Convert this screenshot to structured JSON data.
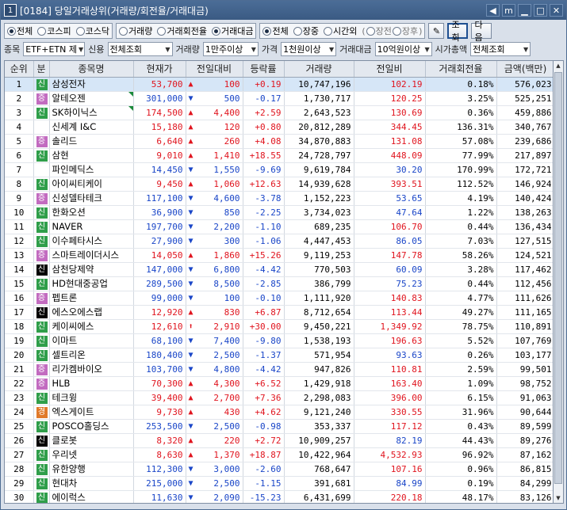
{
  "window": {
    "number": "1",
    "title": "[0184] 당일거래상위(거래량/회전율/거래대금)",
    "pin_label": "m"
  },
  "filters": {
    "market": [
      "전체",
      "코스피",
      "코스닥"
    ],
    "market_selected": 0,
    "rank_type": [
      "거래량",
      "거래회전율",
      "거래대금"
    ],
    "rank_selected": 2,
    "session": [
      "전체",
      "장중",
      "시간외"
    ],
    "session_selected": 0,
    "time_sub": [
      "장전",
      "장후"
    ],
    "query_label": "조회",
    "next_label": "다음",
    "stock_label": "종목",
    "stock_value": "ETF+ETN 제",
    "credit_label": "신용",
    "credit_value": "전체조회",
    "volume_label": "거래량",
    "volume_value": "1만주이상",
    "price_label": "가격",
    "price_value": "1천원이상",
    "amount_label": "거래대금",
    "amount_value": "10억원이상",
    "cap_label": "시가총액",
    "cap_value": "전체조회"
  },
  "columns": [
    "순위",
    "분",
    "종목명",
    "현재가",
    "전일대비",
    "등락률",
    "거래량",
    "전일비",
    "거래회전율",
    "금액(백만)"
  ],
  "rows": [
    {
      "rank": "1",
      "badge": "신",
      "badge_type": "sin",
      "name": "삼성전자",
      "tri": false,
      "price": "53,700",
      "dir": "up",
      "diff": "100",
      "rate": "+0.19",
      "vol": "10,747,196",
      "prev": "102.19",
      "prev_dir": "up",
      "turn": "0.18%",
      "amt": "576,023"
    },
    {
      "rank": "2",
      "badge": "증",
      "badge_type": "jeung",
      "name": "알테오젠",
      "tri": true,
      "price": "301,000",
      "dir": "dn",
      "diff": "500",
      "rate": "-0.17",
      "vol": "1,730,717",
      "prev": "120.25",
      "prev_dir": "up",
      "turn": "3.25%",
      "amt": "525,251"
    },
    {
      "rank": "3",
      "badge": "신",
      "badge_type": "sin",
      "name": "SK하이닉스",
      "tri": true,
      "price": "174,500",
      "dir": "up",
      "diff": "4,400",
      "rate": "+2.59",
      "vol": "2,643,523",
      "prev": "130.69",
      "prev_dir": "up",
      "turn": "0.36%",
      "amt": "459,886"
    },
    {
      "rank": "4",
      "badge": "",
      "badge_type": "none",
      "name": "신세계 I&C",
      "tri": false,
      "price": "15,180",
      "dir": "up",
      "diff": "120",
      "rate": "+0.80",
      "vol": "20,812,289",
      "prev": "344.45",
      "prev_dir": "up",
      "turn": "136.31%",
      "amt": "340,767"
    },
    {
      "rank": "5",
      "badge": "증",
      "badge_type": "jeung",
      "name": "솔리드",
      "tri": false,
      "price": "6,640",
      "dir": "up",
      "diff": "260",
      "rate": "+4.08",
      "vol": "34,870,883",
      "prev": "131.08",
      "prev_dir": "up",
      "turn": "57.08%",
      "amt": "239,686"
    },
    {
      "rank": "6",
      "badge": "신",
      "badge_type": "sin",
      "name": "삼현",
      "tri": false,
      "price": "9,010",
      "dir": "up",
      "diff": "1,410",
      "rate": "+18.55",
      "vol": "24,728,797",
      "prev": "448.09",
      "prev_dir": "up",
      "turn": "77.99%",
      "amt": "217,897"
    },
    {
      "rank": "7",
      "badge": "",
      "badge_type": "none",
      "name": "파인메딕스",
      "tri": false,
      "price": "14,450",
      "dir": "dn",
      "diff": "1,550",
      "rate": "-9.69",
      "vol": "9,619,784",
      "prev": "30.20",
      "prev_dir": "dn",
      "turn": "170.99%",
      "amt": "172,721"
    },
    {
      "rank": "8",
      "badge": "신",
      "badge_type": "sin",
      "name": "아이씨티케이",
      "tri": false,
      "price": "9,450",
      "dir": "up",
      "diff": "1,060",
      "rate": "+12.63",
      "vol": "14,939,628",
      "prev": "393.51",
      "prev_dir": "up",
      "turn": "112.52%",
      "amt": "146,924"
    },
    {
      "rank": "9",
      "badge": "증",
      "badge_type": "jeung",
      "name": "신성델타테크",
      "tri": false,
      "price": "117,100",
      "dir": "dn",
      "diff": "4,600",
      "rate": "-3.78",
      "vol": "1,152,223",
      "prev": "53.65",
      "prev_dir": "dn",
      "turn": "4.19%",
      "amt": "140,424"
    },
    {
      "rank": "10",
      "badge": "신",
      "badge_type": "sin",
      "name": "한화오션",
      "tri": false,
      "price": "36,900",
      "dir": "dn",
      "diff": "850",
      "rate": "-2.25",
      "vol": "3,734,023",
      "prev": "47.64",
      "prev_dir": "dn",
      "turn": "1.22%",
      "amt": "138,263"
    },
    {
      "rank": "11",
      "badge": "신",
      "badge_type": "sin",
      "name": "NAVER",
      "tri": false,
      "price": "197,700",
      "dir": "dn",
      "diff": "2,200",
      "rate": "-1.10",
      "vol": "689,235",
      "prev": "106.70",
      "prev_dir": "up",
      "turn": "0.44%",
      "amt": "136,434"
    },
    {
      "rank": "12",
      "badge": "신",
      "badge_type": "sin",
      "name": "이수페타시스",
      "tri": false,
      "price": "27,900",
      "dir": "dn",
      "diff": "300",
      "rate": "-1.06",
      "vol": "4,447,453",
      "prev": "86.05",
      "prev_dir": "dn",
      "turn": "7.03%",
      "amt": "127,515"
    },
    {
      "rank": "13",
      "badge": "증",
      "badge_type": "jeung",
      "name": "스마트레이더시스",
      "tri": false,
      "price": "14,050",
      "dir": "up",
      "diff": "1,860",
      "rate": "+15.26",
      "vol": "9,119,253",
      "prev": "147.78",
      "prev_dir": "up",
      "turn": "58.26%",
      "amt": "124,521"
    },
    {
      "rank": "14",
      "badge": "신",
      "badge_type": "blk",
      "name": "삼천당제약",
      "tri": false,
      "price": "147,000",
      "dir": "dn",
      "diff": "6,800",
      "rate": "-4.42",
      "vol": "770,503",
      "prev": "60.09",
      "prev_dir": "dn",
      "turn": "3.28%",
      "amt": "117,462"
    },
    {
      "rank": "15",
      "badge": "신",
      "badge_type": "sin",
      "name": "HD현대중공업",
      "tri": false,
      "price": "289,500",
      "dir": "dn",
      "diff": "8,500",
      "rate": "-2.85",
      "vol": "386,799",
      "prev": "75.23",
      "prev_dir": "dn",
      "turn": "0.44%",
      "amt": "112,456"
    },
    {
      "rank": "16",
      "badge": "증",
      "badge_type": "jeung",
      "name": "펩트론",
      "tri": false,
      "price": "99,000",
      "dir": "dn",
      "diff": "100",
      "rate": "-0.10",
      "vol": "1,111,920",
      "prev": "140.83",
      "prev_dir": "up",
      "turn": "4.77%",
      "amt": "111,626"
    },
    {
      "rank": "17",
      "badge": "신",
      "badge_type": "blk",
      "name": "에스오에스랩",
      "tri": false,
      "price": "12,920",
      "dir": "up",
      "diff": "830",
      "rate": "+6.87",
      "vol": "8,712,654",
      "prev": "113.44",
      "prev_dir": "up",
      "turn": "49.27%",
      "amt": "111,165"
    },
    {
      "rank": "18",
      "badge": "신",
      "badge_type": "sin",
      "name": "케이씨에스",
      "tri": false,
      "price": "12,610",
      "dir": "up",
      "diff": "2,910",
      "rate": "+30.00",
      "vol": "9,450,221",
      "prev": "1,349.92",
      "prev_dir": "up",
      "turn": "78.75%",
      "amt": "110,891"
    },
    {
      "rank": "19",
      "badge": "신",
      "badge_type": "sin",
      "name": "이마트",
      "tri": false,
      "price": "68,100",
      "dir": "dn",
      "diff": "7,400",
      "rate": "-9.80",
      "vol": "1,538,193",
      "prev": "196.63",
      "prev_dir": "up",
      "turn": "5.52%",
      "amt": "107,769"
    },
    {
      "rank": "20",
      "badge": "신",
      "badge_type": "sin",
      "name": "셀트리온",
      "tri": false,
      "price": "180,400",
      "dir": "dn",
      "diff": "2,500",
      "rate": "-1.37",
      "vol": "571,954",
      "prev": "93.63",
      "prev_dir": "dn",
      "turn": "0.26%",
      "amt": "103,177"
    },
    {
      "rank": "21",
      "badge": "증",
      "badge_type": "jeung",
      "name": "리가켐바이오",
      "tri": false,
      "price": "103,700",
      "dir": "dn",
      "diff": "4,800",
      "rate": "-4.42",
      "vol": "947,826",
      "prev": "110.81",
      "prev_dir": "up",
      "turn": "2.59%",
      "amt": "99,501"
    },
    {
      "rank": "22",
      "badge": "증",
      "badge_type": "jeung",
      "name": "HLB",
      "tri": false,
      "price": "70,300",
      "dir": "up",
      "diff": "4,300",
      "rate": "+6.52",
      "vol": "1,429,918",
      "prev": "163.40",
      "prev_dir": "up",
      "turn": "1.09%",
      "amt": "98,752"
    },
    {
      "rank": "23",
      "badge": "신",
      "badge_type": "sin",
      "name": "테크윙",
      "tri": false,
      "price": "39,400",
      "dir": "up",
      "diff": "2,700",
      "rate": "+7.36",
      "vol": "2,298,083",
      "prev": "396.00",
      "prev_dir": "up",
      "turn": "6.15%",
      "amt": "91,063"
    },
    {
      "rank": "24",
      "badge": "경",
      "badge_type": "gyeong",
      "name": "엑스게이트",
      "tri": false,
      "price": "9,730",
      "dir": "up",
      "diff": "430",
      "rate": "+4.62",
      "vol": "9,121,240",
      "prev": "330.55",
      "prev_dir": "up",
      "turn": "31.96%",
      "amt": "90,644"
    },
    {
      "rank": "25",
      "badge": "신",
      "badge_type": "sin",
      "name": "POSCO홀딩스",
      "tri": false,
      "price": "253,500",
      "dir": "dn",
      "diff": "2,500",
      "rate": "-0.98",
      "vol": "353,337",
      "prev": "117.12",
      "prev_dir": "up",
      "turn": "0.43%",
      "amt": "89,599"
    },
    {
      "rank": "26",
      "badge": "신",
      "badge_type": "blk",
      "name": "클로봇",
      "tri": false,
      "price": "8,320",
      "dir": "up",
      "diff": "220",
      "rate": "+2.72",
      "vol": "10,909,257",
      "prev": "82.19",
      "prev_dir": "dn",
      "turn": "44.43%",
      "amt": "89,276"
    },
    {
      "rank": "27",
      "badge": "신",
      "badge_type": "sin",
      "name": "우리넷",
      "tri": false,
      "price": "8,630",
      "dir": "up",
      "diff": "1,370",
      "rate": "+18.87",
      "vol": "10,422,964",
      "prev": "4,532.93",
      "prev_dir": "up",
      "turn": "96.92%",
      "amt": "87,162"
    },
    {
      "rank": "28",
      "badge": "신",
      "badge_type": "sin",
      "name": "유한양행",
      "tri": false,
      "price": "112,300",
      "dir": "dn",
      "diff": "3,000",
      "rate": "-2.60",
      "vol": "768,647",
      "prev": "107.16",
      "prev_dir": "up",
      "turn": "0.96%",
      "amt": "86,815"
    },
    {
      "rank": "29",
      "badge": "신",
      "badge_type": "sin",
      "name": "현대차",
      "tri": false,
      "price": "215,000",
      "dir": "dn",
      "diff": "2,500",
      "rate": "-1.15",
      "vol": "391,681",
      "prev": "84.99",
      "prev_dir": "dn",
      "turn": "0.19%",
      "amt": "84,299"
    },
    {
      "rank": "30",
      "badge": "신",
      "badge_type": "sin",
      "name": "에이럭스",
      "tri": false,
      "price": "11,630",
      "dir": "dn",
      "diff": "2,090",
      "rate": "-15.23",
      "vol": "6,431,699",
      "prev": "220.18",
      "prev_dir": "up",
      "turn": "48.17%",
      "amt": "83,126"
    }
  ],
  "colors": {
    "up": "#e0141e",
    "down": "#1a46c8",
    "title_bar": "#3f6089",
    "selected_row": "#d6e6f7"
  }
}
